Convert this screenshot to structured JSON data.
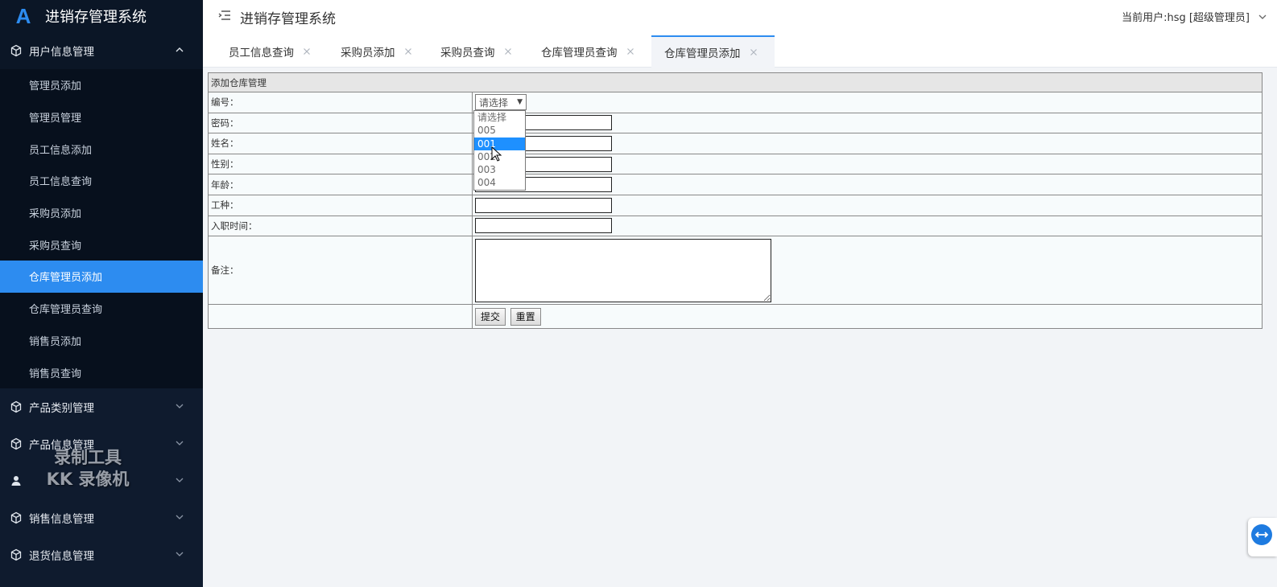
{
  "app": {
    "title": "进销存管理系统"
  },
  "header": {
    "title": "进销存管理系统",
    "user": "当前用户:hsg [超级管理员]"
  },
  "sidebar": {
    "groups": [
      {
        "label": "用户信息管理",
        "open": true,
        "items": [
          "管理员添加",
          "管理员管理",
          "员工信息添加",
          "员工信息查询",
          "采购员添加",
          "采购员查询",
          "仓库管理员添加",
          "仓库管理员查询",
          "销售员添加",
          "销售员查询"
        ],
        "active": "仓库管理员添加"
      },
      {
        "label": "产品类别管理"
      },
      {
        "label": "产品信息管理"
      },
      {
        "label": ""
      },
      {
        "label": "销售信息管理"
      },
      {
        "label": "退货信息管理"
      }
    ]
  },
  "watermark": {
    "line1": "录制工具",
    "line2": "KK 录像机"
  },
  "tabs": [
    {
      "label": "员工信息查询"
    },
    {
      "label": "采购员添加"
    },
    {
      "label": "采购员查询"
    },
    {
      "label": "仓库管理员查询"
    },
    {
      "label": "仓库管理员添加",
      "active": true
    }
  ],
  "form": {
    "heading": "添加仓库管理",
    "fields": {
      "id": "编号：",
      "password": "密码：",
      "name": "姓名：",
      "gender": "性别：",
      "age": "年龄：",
      "job_type": "工种：",
      "hire_date": "入职时间：",
      "remark": "备注："
    },
    "select": {
      "value": "请选择",
      "options": [
        "请选择",
        "005",
        "001",
        "002",
        "003",
        "004"
      ],
      "highlighted": "001"
    },
    "buttons": {
      "submit": "提交",
      "reset": "重置"
    }
  },
  "colors": {
    "accent": "#2d8cf0",
    "sidebar_bg": "#0f1b2e",
    "dropdown_highlight": "#1e90ff"
  }
}
